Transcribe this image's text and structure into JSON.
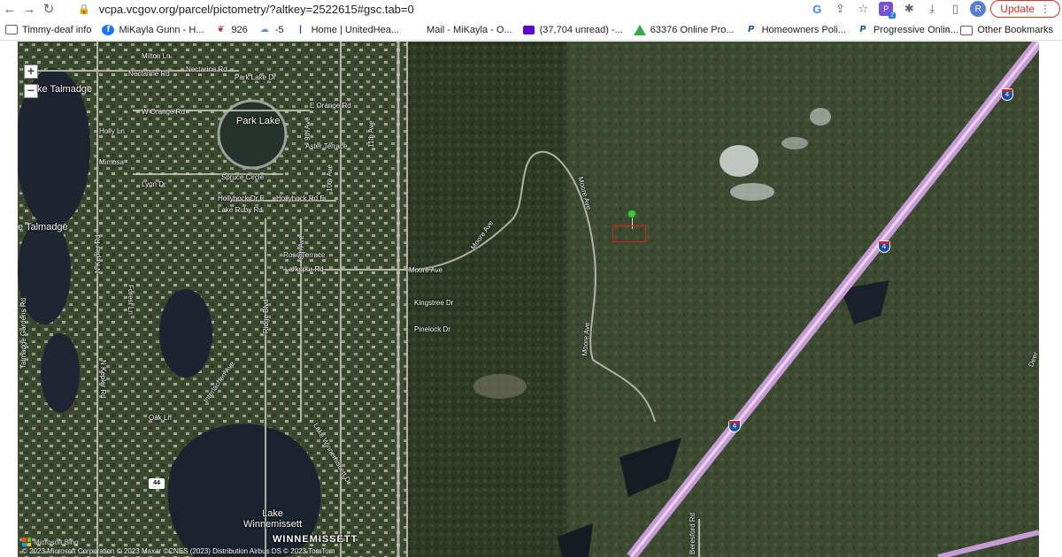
{
  "browser": {
    "url": "vcpa.vcgov.org/parcel/pictometry/?altkey=2522615#gsc.tab=0",
    "update_label": "Update",
    "profile_initial": "R",
    "extension_badge": "2"
  },
  "bookmarks": {
    "items": [
      {
        "label": "Timmy-deaf info",
        "icon": "folder-icon"
      },
      {
        "label": "MiKayla Gunn - H...",
        "icon": "facebook-icon"
      },
      {
        "label": "926",
        "icon": "paw-icon"
      },
      {
        "label": "-5",
        "icon": "weather-icon"
      },
      {
        "label": "Home | UnitedHea...",
        "icon": "uhc-icon"
      },
      {
        "label": "Mail - MiKayla - O...",
        "icon": "microsoft-icon"
      },
      {
        "label": "(37,704 unread) -...",
        "icon": "yahoo-mail-icon"
      },
      {
        "label": "63376 Online Pro...",
        "icon": "ads-icon"
      },
      {
        "label": "Homeowners Poli...",
        "icon": "progressive-icon"
      },
      {
        "label": "Progressive Onlin...",
        "icon": "progressive-icon"
      }
    ],
    "overflow_label": "»",
    "other_label": "Other Bookmarks"
  },
  "map": {
    "zoom_in": "+",
    "zoom_out": "−",
    "labels": {
      "milton_ln": "Milton Ln",
      "nectarine_rd_w": "Nectarine Rd",
      "nectarine_rd_e": "Nectarine Rd",
      "park_lake_dr": "Park Lake Dr",
      "talmadge_1": "ke Talmadge",
      "talmadge_2": "e Talmadge",
      "w_orange_rd": "W Orange Rd",
      "e_orange_rd": "E Orange Rd",
      "park_lake": "Park Lake",
      "holly_ln": "Holly Ln",
      "mimosa": "Mimosa",
      "aster_terrace": "Aster Terrace",
      "spruce_circle": "Spruce Circle",
      "lyon_dr": "Lyon Dr",
      "hollyhock_dr_e": "Hollyhock Dr E",
      "hollyhock_rd_e": "Hollyhock Rd E",
      "lake_ruby_rd": "Lake Ruby Rd",
      "rose_terrace": "Rose Terrace",
      "larkspur_rd": "Larkspur Rd",
      "moore_ave_1": "Moore Ave",
      "moore_ave_2": "Moore Ave",
      "moore_ave_3": "Moore Ave",
      "moore_ave_4": "Moore Ave",
      "kingstree_dr": "Kingstree Dr",
      "pinelock_dr": "Pinelock Dr",
      "oak_ln": "Oak Ln",
      "lake_winnemissett": "Lake\nWinnemissett",
      "winnemissett": "WINNEMISSETT",
      "nkepler_rd": "N Kepler Rd",
      "kepler_rd": "N Kepler Rd",
      "ridge_blvd": "Ridge Blvd",
      "talmadge_gardens": "Talmadge Gardens Rd",
      "eighth_ave": "8th Ave",
      "ninth_ave": "9th Ave",
      "tenth_ave": "10th Ave",
      "eleventh_ave": "11th Ave",
      "route_44": "44",
      "i4": "4",
      "forest_ln": "Forest Ln",
      "interlachen": "Interlachen Ave",
      "lake_winn_dr": "Lake Winnemissett Dr",
      "beresford": "Beresford Rd",
      "deer": "Deer"
    },
    "copyright": "© 2023 Microsoft Corporation © 2023 Maxar ©CNES (2023) Distribution Airbus DS © 2023 TomTom",
    "bing_label": "Microsoft Bing",
    "highway_color": "#c79bd6",
    "parcel_color": "#e02020",
    "pin_color": "#3fc43f"
  }
}
